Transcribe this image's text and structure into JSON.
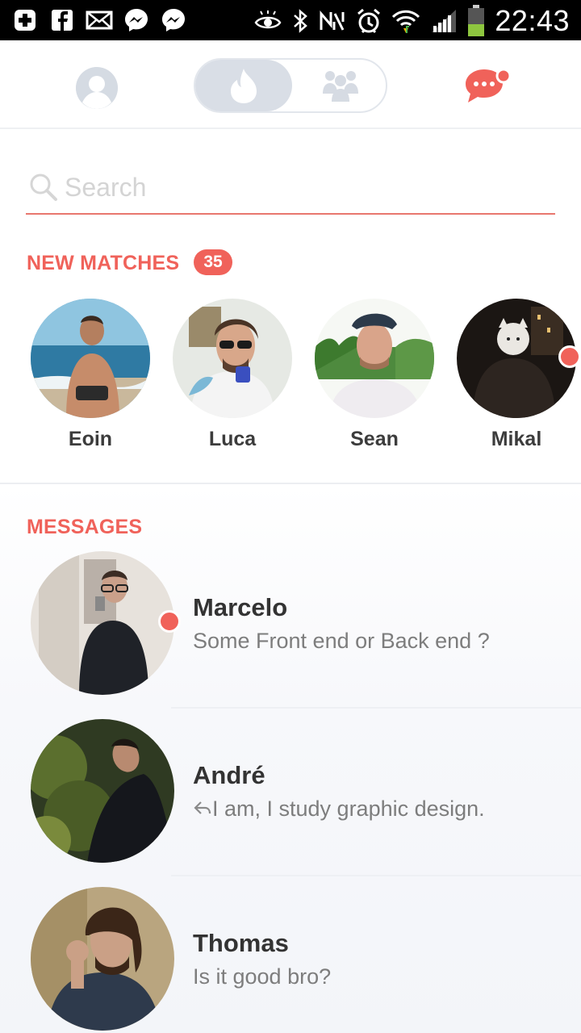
{
  "status_bar": {
    "time": "22:43",
    "left_icons": [
      "plus-box-icon",
      "facebook-icon",
      "mail-icon",
      "messenger-icon",
      "messenger-icon"
    ],
    "right_icons": [
      "eye-icon",
      "bluetooth-icon",
      "nfc-icon",
      "alarm-icon",
      "wifi-icon",
      "signal-icon",
      "battery-icon"
    ]
  },
  "header": {
    "profile_icon": "user-icon",
    "toggle_active_icon": "flame-icon",
    "toggle_inactive_icon": "group-icon",
    "chat_icon": "chat-bubble-icon"
  },
  "search": {
    "placeholder": "Search",
    "value": ""
  },
  "new_matches": {
    "title": "NEW MATCHES",
    "count": "35",
    "items": [
      {
        "name": "Eoin",
        "unread": false
      },
      {
        "name": "Luca",
        "unread": false
      },
      {
        "name": "Sean",
        "unread": false
      },
      {
        "name": "Mikal",
        "unread": true
      }
    ]
  },
  "messages": {
    "title": "MESSAGES",
    "items": [
      {
        "name": "Marcelo",
        "text": "Some Front end or Back end ?",
        "unread": true,
        "replied": false
      },
      {
        "name": "André",
        "text": "I am, I study graphic design.",
        "unread": false,
        "replied": true,
        "reply_icon": "reply-arrow-icon"
      },
      {
        "name": "Thomas",
        "text": "Is it good bro?",
        "unread": false,
        "replied": false
      }
    ]
  },
  "colors": {
    "accent": "#f0625a",
    "inactive": "#d9dee6",
    "text_dark": "#333333",
    "text_muted": "#7d7d7d"
  }
}
